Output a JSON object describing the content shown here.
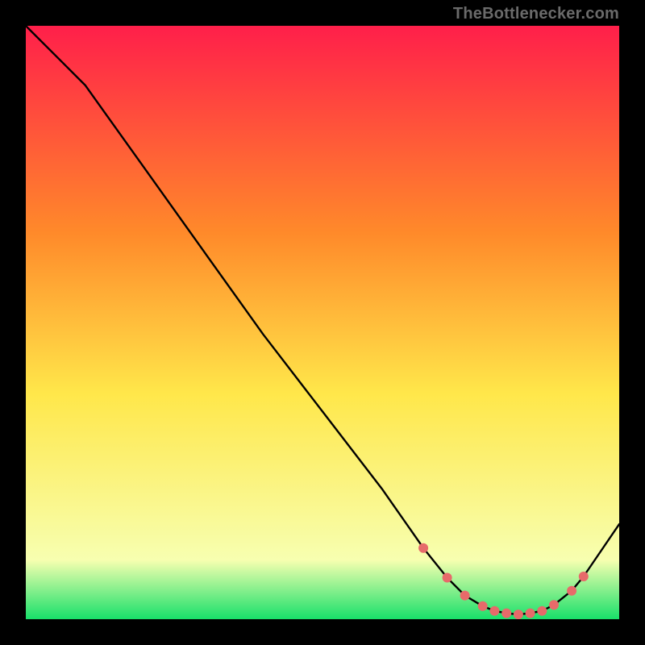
{
  "attribution": "TheBottlenecker.com",
  "colors": {
    "bg": "#000000",
    "grad_top": "#ff1f4a",
    "grad_mid1": "#ff8a2a",
    "grad_mid2": "#ffe74a",
    "grad_low": "#f7ffb0",
    "grad_bottom": "#18e06a",
    "curve": "#000000",
    "marker": "#e76a6a"
  },
  "chart_data": {
    "type": "line",
    "title": "",
    "xlabel": "",
    "ylabel": "",
    "xlim": [
      0,
      100
    ],
    "ylim": [
      0,
      100
    ],
    "series": [
      {
        "name": "bottleneck-curve",
        "x": [
          0,
          6,
          10,
          20,
          30,
          40,
          50,
          60,
          67,
          71,
          74,
          77,
          79,
          81,
          83,
          85,
          87,
          89,
          92,
          94,
          100
        ],
        "y": [
          100,
          94,
          90,
          76,
          62,
          48,
          35,
          22,
          12,
          7,
          4,
          2.2,
          1.4,
          1.0,
          0.8,
          1.0,
          1.4,
          2.4,
          4.8,
          7.2,
          16
        ]
      }
    ],
    "markers": {
      "name": "highlight-points",
      "x": [
        67,
        71,
        74,
        77,
        79,
        81,
        83,
        85,
        87,
        89,
        92,
        94
      ],
      "y": [
        12,
        7,
        4,
        2.2,
        1.4,
        1.0,
        0.8,
        1.0,
        1.4,
        2.4,
        4.8,
        7.2
      ]
    }
  }
}
